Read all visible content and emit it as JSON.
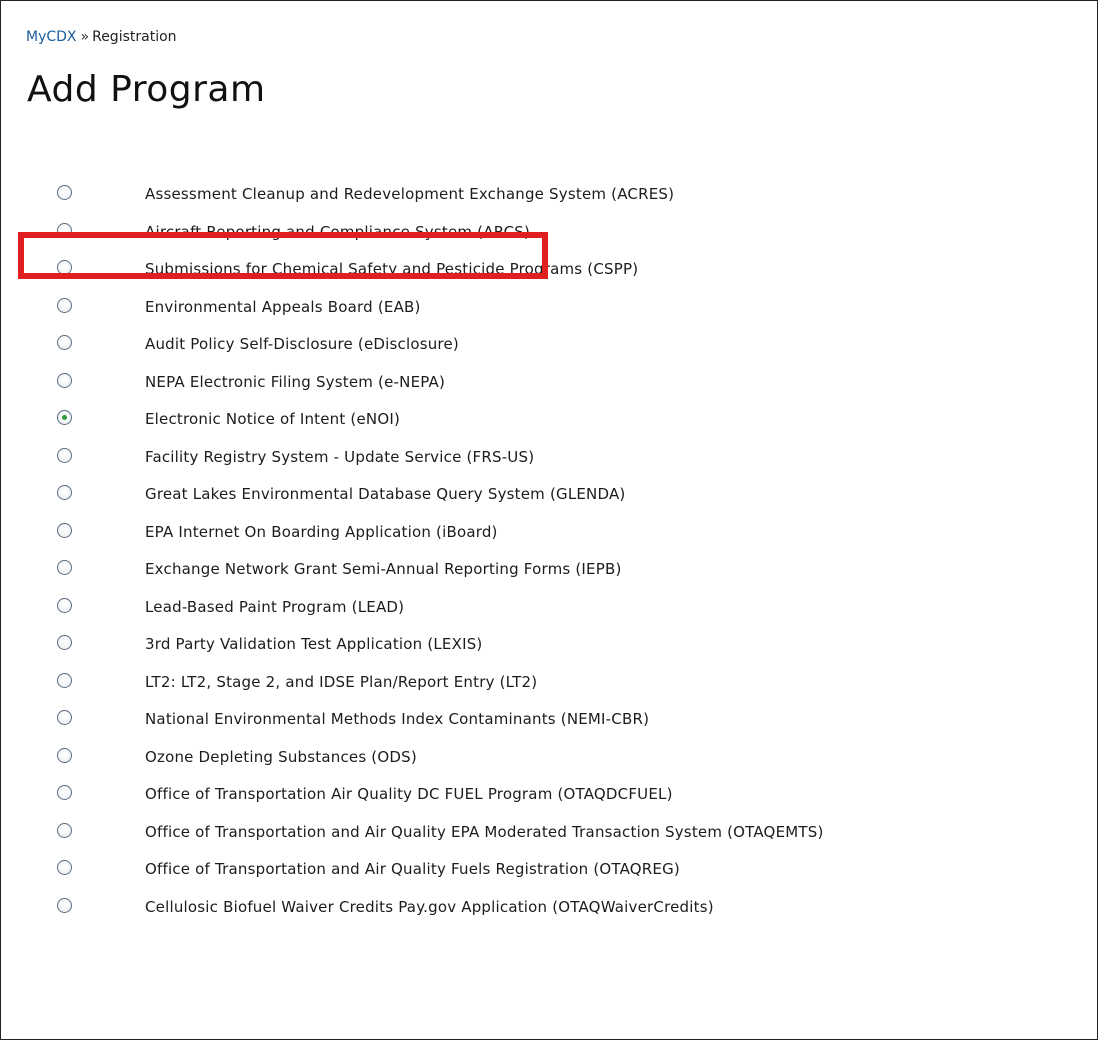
{
  "breadcrumb": {
    "home": "MyCDX",
    "separator": "»",
    "current": "Registration"
  },
  "page_title": "Add Program",
  "selected_program": "Electronic Notice of Intent (eNOI)",
  "colors": {
    "highlight": "#e02020",
    "link": "#1a5d9b",
    "radio_selected_dot": "#2f9a3a"
  },
  "programs": [
    {
      "label": "Assessment Cleanup and Redevelopment Exchange System (ACRES)",
      "selected": false
    },
    {
      "label": "Aircraft Reporting and Compliance System (ARCS)",
      "selected": false
    },
    {
      "label": "Submissions for Chemical Safety and Pesticide Programs (CSPP)",
      "selected": false
    },
    {
      "label": "Environmental Appeals Board (EAB)",
      "selected": false
    },
    {
      "label": "Audit Policy Self-Disclosure (eDisclosure)",
      "selected": false
    },
    {
      "label": "NEPA Electronic Filing System (e-NEPA)",
      "selected": false
    },
    {
      "label": "Electronic Notice of Intent (eNOI)",
      "selected": true
    },
    {
      "label": "Facility Registry System - Update Service (FRS-US)",
      "selected": false
    },
    {
      "label": "Great Lakes Environmental Database Query System (GLENDA)",
      "selected": false
    },
    {
      "label": "EPA Internet On Boarding Application (iBoard)",
      "selected": false
    },
    {
      "label": "Exchange Network Grant Semi-Annual Reporting Forms (IEPB)",
      "selected": false
    },
    {
      "label": "Lead-Based Paint Program (LEAD)",
      "selected": false
    },
    {
      "label": "3rd Party Validation Test Application (LEXIS)",
      "selected": false
    },
    {
      "label": "LT2: LT2, Stage 2, and IDSE Plan/Report Entry (LT2)",
      "selected": false
    },
    {
      "label": "National Environmental Methods Index Contaminants (NEMI-CBR)",
      "selected": false
    },
    {
      "label": "Ozone Depleting Substances (ODS)",
      "selected": false
    },
    {
      "label": "Office of Transportation Air Quality DC FUEL Program (OTAQDCFUEL)",
      "selected": false
    },
    {
      "label": "Office of Transportation and Air Quality EPA Moderated Transaction System (OTAQEMTS)",
      "selected": false
    },
    {
      "label": "Office of Transportation and Air Quality Fuels Registration (OTAQREG)",
      "selected": false
    },
    {
      "label": "Cellulosic Biofuel Waiver Credits Pay.gov Application (OTAQWaiverCredits)",
      "selected": false
    }
  ]
}
